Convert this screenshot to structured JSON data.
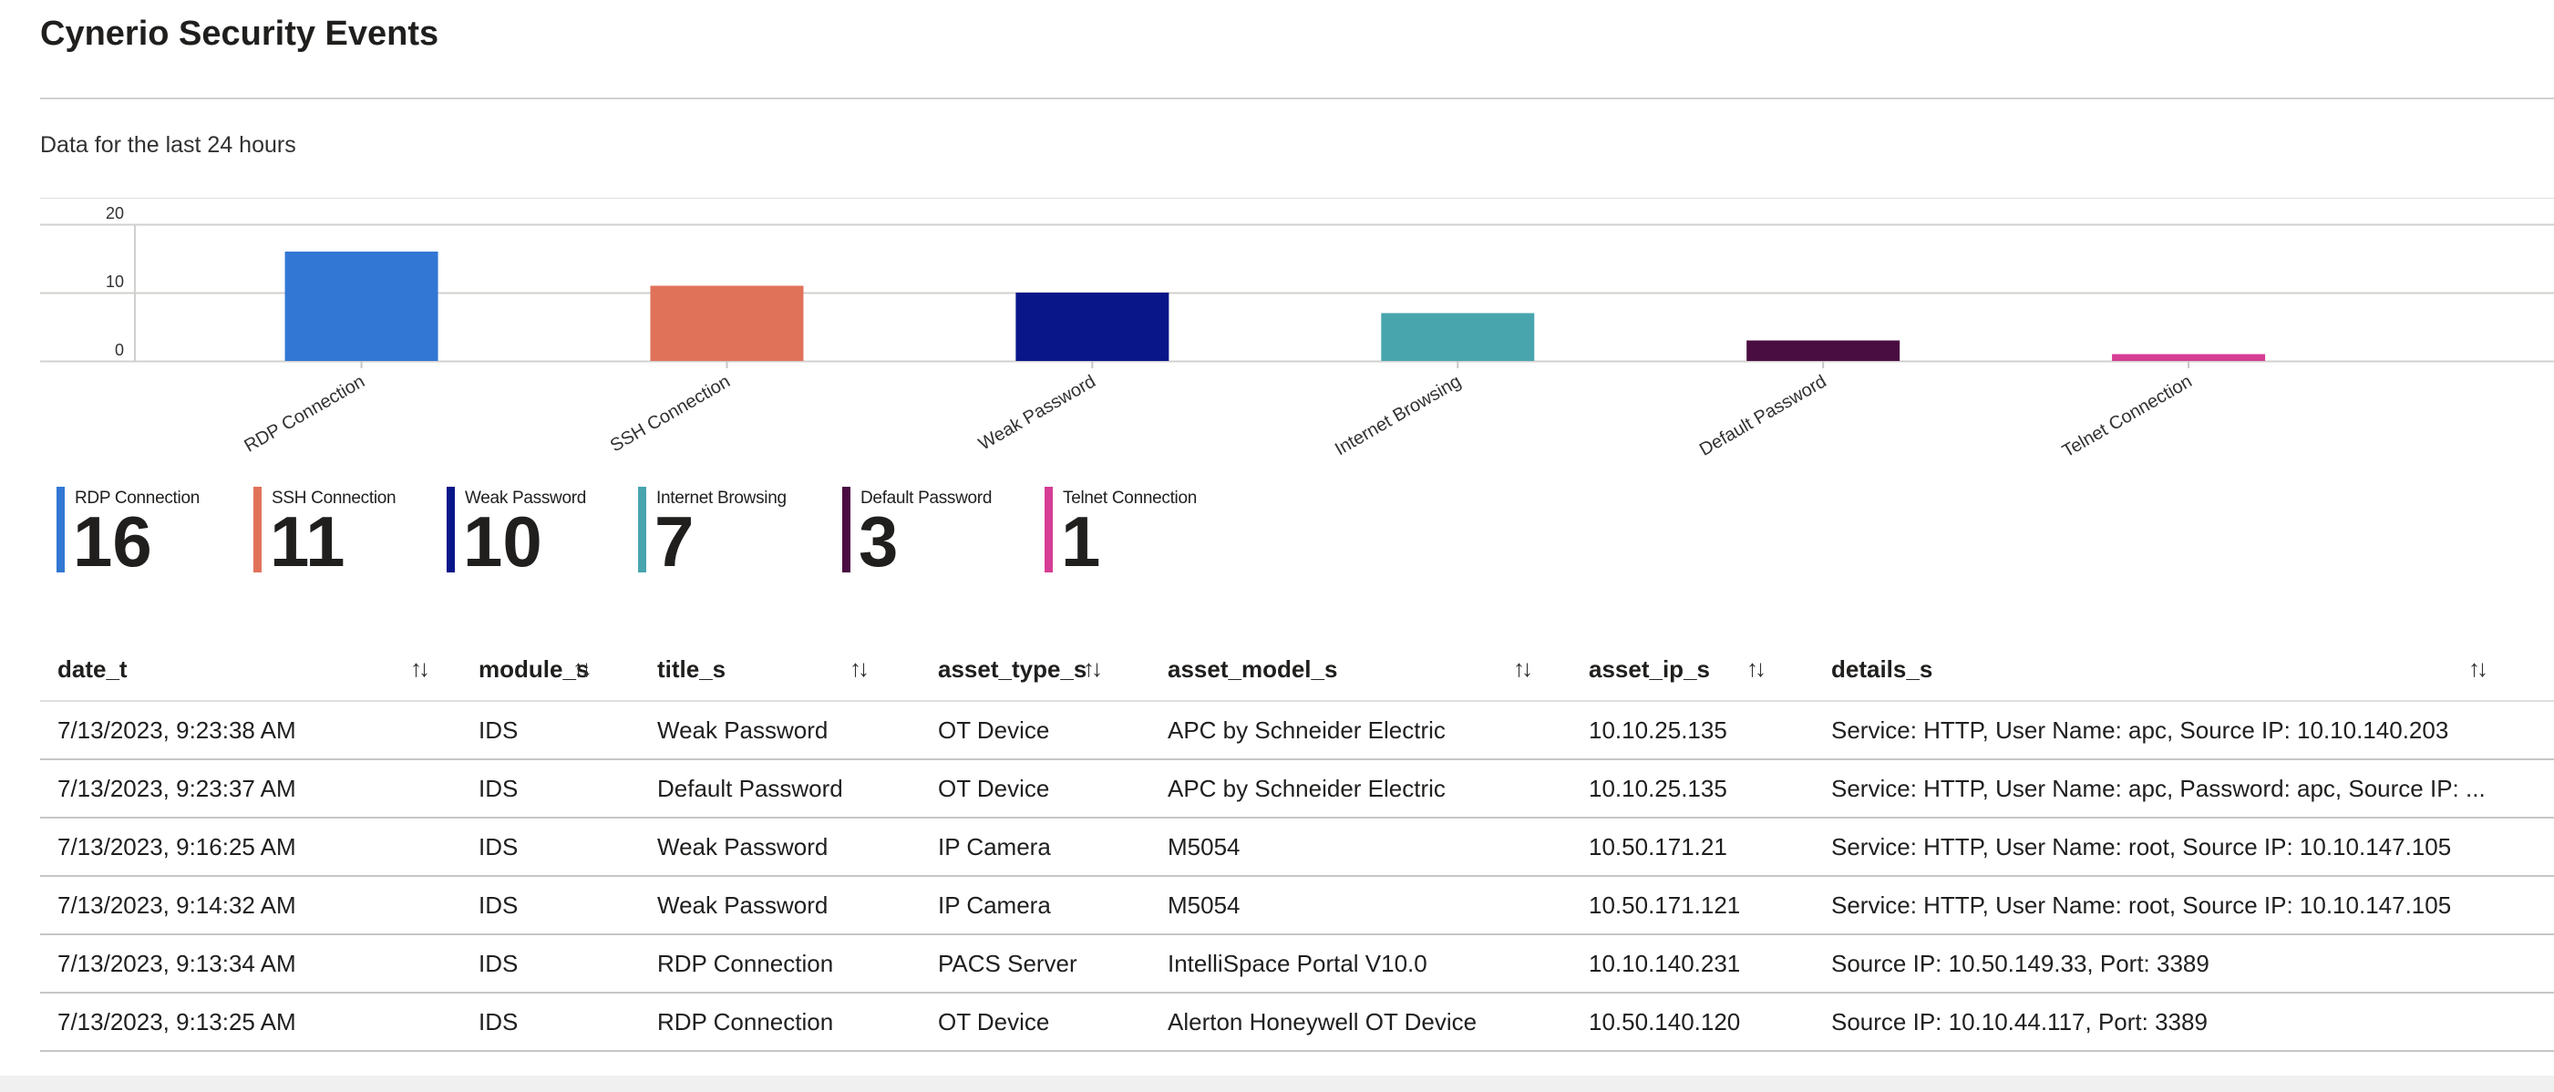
{
  "page": {
    "title": "Cynerio Security Events",
    "subtitle": "Data for the last 24 hours"
  },
  "chart_data": {
    "type": "bar",
    "categories": [
      "RDP Connection",
      "SSH Connection",
      "Weak Password",
      "Internet Browsing",
      "Default Password",
      "Telnet Connection"
    ],
    "values": [
      16,
      11,
      10,
      7,
      3,
      1
    ],
    "colors": [
      "#3277d4",
      "#e0725a",
      "#09168a",
      "#48a5ae",
      "#4a0d42",
      "#d63d95"
    ],
    "yticks": [
      0,
      10,
      20
    ],
    "ylim": [
      0,
      20
    ],
    "grid": true,
    "title": "",
    "xlabel": "",
    "ylabel": ""
  },
  "tiles": [
    {
      "label": "RDP Connection",
      "value": "16",
      "color": "#3277d4"
    },
    {
      "label": "SSH Connection",
      "value": "11",
      "color": "#e0725a"
    },
    {
      "label": "Weak Password",
      "value": "10",
      "color": "#09168a"
    },
    {
      "label": "Internet Browsing",
      "value": "7",
      "color": "#48a5ae"
    },
    {
      "label": "Default Password",
      "value": "3",
      "color": "#4a0d42"
    },
    {
      "label": "Telnet Connection",
      "value": "1",
      "color": "#d63d95"
    }
  ],
  "table": {
    "columns": [
      "date_t",
      "module_s",
      "title_s",
      "asset_type_s",
      "asset_model_s",
      "asset_ip_s",
      "details_s"
    ],
    "sort_icon": "↑↓",
    "rows": [
      [
        "7/13/2023, 9:23:38 AM",
        "IDS",
        "Weak Password",
        "OT Device",
        "APC by Schneider Electric",
        "10.10.25.135",
        "Service: HTTP, User Name: apc, Source IP: 10.10.140.203"
      ],
      [
        "7/13/2023, 9:23:37 AM",
        "IDS",
        "Default Password",
        "OT Device",
        "APC by Schneider Electric",
        "10.10.25.135",
        "Service: HTTP, User Name: apc, Password: apc, Source IP: ..."
      ],
      [
        "7/13/2023, 9:16:25 AM",
        "IDS",
        "Weak Password",
        "IP Camera",
        "M5054",
        "10.50.171.21",
        "Service: HTTP, User Name: root, Source IP: 10.10.147.105"
      ],
      [
        "7/13/2023, 9:14:32 AM",
        "IDS",
        "Weak Password",
        "IP Camera",
        "M5054",
        "10.50.171.121",
        "Service: HTTP, User Name: root, Source IP: 10.10.147.105"
      ],
      [
        "7/13/2023, 9:13:34 AM",
        "IDS",
        "RDP Connection",
        "PACS Server",
        "IntelliSpace Portal V10.0",
        "10.10.140.231",
        "Source IP: 10.50.149.33, Port: 3389"
      ],
      [
        "7/13/2023, 9:13:25 AM",
        "IDS",
        "RDP Connection",
        "OT Device",
        "Alerton Honeywell OT Device",
        "10.50.140.120",
        "Source IP: 10.10.44.117, Port: 3389"
      ]
    ]
  }
}
